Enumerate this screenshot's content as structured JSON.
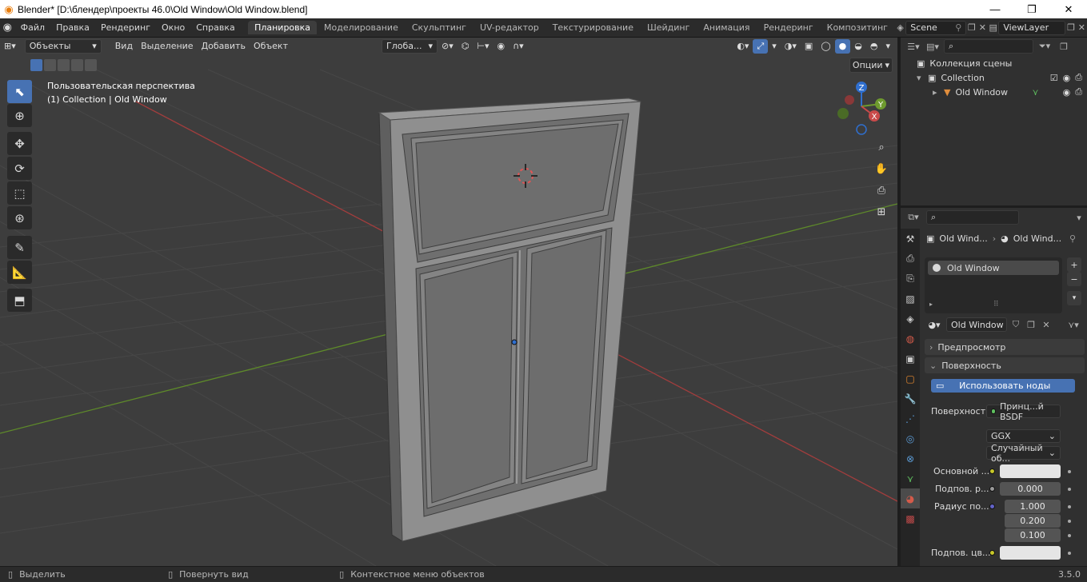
{
  "titlebar": {
    "title": "Blender* [D:\\блендер\\проекты 46.0\\Old Window\\Old Window.blend]",
    "minimize": "—",
    "maximize": "❐",
    "close": "✕"
  },
  "menu": {
    "items": [
      "Файл",
      "Правка",
      "Рендеринг",
      "Окно",
      "Справка"
    ]
  },
  "workspaces": {
    "tabs": [
      "Планировка",
      "Моделирование",
      "Скульптинг",
      "UV-редактор",
      "Текстурирование",
      "Шейдинг",
      "Анимация",
      "Рендеринг",
      "Композитинг"
    ],
    "active": 0
  },
  "scene": {
    "name": "Scene",
    "view_layer": "ViewLayer"
  },
  "viewport": {
    "mode": "Объекты",
    "menus": [
      "Вид",
      "Выделение",
      "Добавить",
      "Объект"
    ],
    "orientation": "Глоба...",
    "options": "Опции",
    "perspective_label": "Пользовательская перспектива",
    "collection_label": "(1) Collection | Old Window"
  },
  "gizmo": {
    "x": "X",
    "y": "Y",
    "z": "Z"
  },
  "outliner": {
    "scene_collection": "Коллекция сцены",
    "collection": "Collection",
    "object": "Old Window"
  },
  "properties": {
    "breadcrumb_object": "Old Wind...",
    "breadcrumb_material": "Old Wind...",
    "slot_name": "Old Window",
    "material_name": "Old Window",
    "panel_preview": "Предпросмотр",
    "panel_surface": "Поверхность",
    "use_nodes": "Использовать ноды",
    "surface_label": "Поверхность",
    "surface_value": "Принц...й BSDF",
    "distribution": "GGX",
    "subsurface_method": "Случайный об...",
    "base_color_label": "Основной ...",
    "subsurface_label": "Подпов. р...",
    "subsurface_value": "0.000",
    "radius_label": "Радиус по...",
    "radius_values": [
      "1.000",
      "0.200",
      "0.100"
    ],
    "subsurface_color_label": "Подпов. цв..."
  },
  "statusbar": {
    "select": "Выделить",
    "rotate": "Повернуть вид",
    "context": "Контекстное меню объектов",
    "version": "3.5.0"
  },
  "colors": {
    "accent": "#4772b3",
    "axis_x": "#c94a4a",
    "axis_y": "#6e9a2e",
    "axis_z": "#2f6fcf",
    "viewport_bg": "#3d3d3d"
  }
}
